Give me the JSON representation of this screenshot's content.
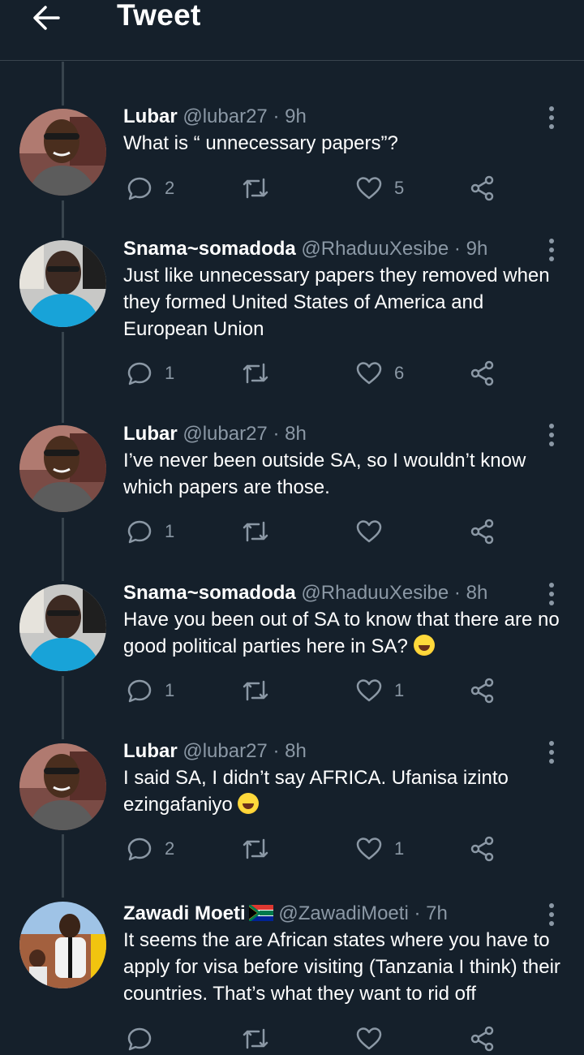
{
  "header": {
    "title": "Tweet"
  },
  "tweets": [
    {
      "name": "Lubar",
      "handle": "@lubar27",
      "sep": "·",
      "time": "9h",
      "text": "What is “ unnecessary papers”?",
      "replies": "2",
      "retweets": "",
      "likes": "5"
    },
    {
      "name": "Snama~somadoda",
      "handle": "@RhaduuXesibe",
      "sep": "·",
      "time": "9h",
      "text": "Just like unnecessary papers they removed when they formed United States of America and European Union",
      "replies": "1",
      "retweets": "",
      "likes": "6"
    },
    {
      "name": "Lubar",
      "handle": "@lubar27",
      "sep": "·",
      "time": "8h",
      "text": "I’ve never been outside SA, so I wouldn’t know which papers are those.",
      "replies": "1",
      "retweets": "",
      "likes": ""
    },
    {
      "name": "Snama~somadoda",
      "handle": "@RhaduuXesibe",
      "sep": "·",
      "time": "8h",
      "text": "Have you been out of SA to know that there are no good political parties here in SA?",
      "replies": "1",
      "retweets": "",
      "likes": "1"
    },
    {
      "name": "Lubar",
      "handle": "@lubar27",
      "sep": "·",
      "time": "8h",
      "text": "I said SA, I didn’t say AFRICA. Ufanisa izinto ezingafaniyo",
      "replies": "2",
      "retweets": "",
      "likes": "1"
    },
    {
      "name": "Zawadi Moeti",
      "handle": "@ZawadiMoeti",
      "sep": "·",
      "time": "7h",
      "text": "It seems the are African states where you have to apply for visa before visiting (Tanzania I think) their countries. That’s what they want to rid off",
      "replies": "",
      "retweets": "",
      "likes": ""
    }
  ],
  "icons": {
    "back": "arrow-left-icon",
    "more": "more-vertical-icon",
    "reply": "reply-icon",
    "retweet": "retweet-icon",
    "like": "heart-icon",
    "share": "share-icon",
    "emoji": "laughing-emoji",
    "flag": "south-africa-flag"
  },
  "colors": {
    "background": "#15202b",
    "muted": "#8b98a5",
    "divider": "#38444d",
    "text": "#ffffff"
  }
}
